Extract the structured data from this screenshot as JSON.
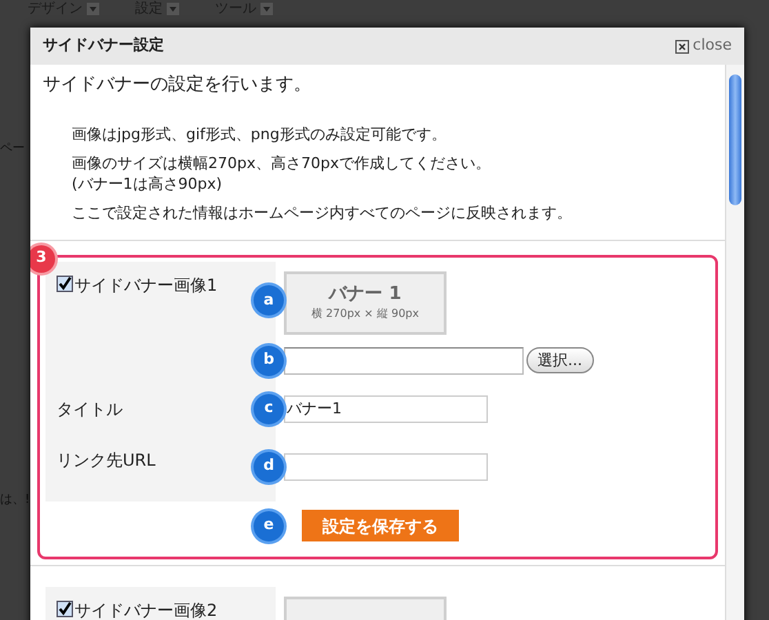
{
  "background_page": {
    "menu": [
      {
        "label": "デザイン"
      },
      {
        "label": "設定"
      },
      {
        "label": "ツール"
      }
    ],
    "left_fragments": [
      "ペー",
      "は、!"
    ]
  },
  "dialog": {
    "title": "サイドバナー設定",
    "close": "close",
    "intro": "サイドバナーの設定を行います。",
    "notes": [
      "画像はjpg形式、gif形式、png形式のみ設定可能です。",
      "画像のサイズは横幅270px、高さ70pxで作成してください。\n(バナー1は高さ90px)",
      "ここで設定された情報はホームページ内すべてのページに反映されます。"
    ],
    "callout": "3",
    "sections": [
      {
        "enabled": true,
        "highlighted": true,
        "label": "サイドバナー画像1",
        "preview_title": "バナー 1",
        "preview_size": "横 270px × 縦 90px",
        "file_button": "選択...",
        "title_label": "タイトル",
        "title_value": "バナー1",
        "url_label": "リンク先URL",
        "save": "設定を保存する",
        "markers": [
          "a",
          "b",
          "c",
          "d",
          "e"
        ]
      },
      {
        "enabled": true,
        "highlighted": false,
        "label": "サイドバナー画像2"
      }
    ]
  }
}
